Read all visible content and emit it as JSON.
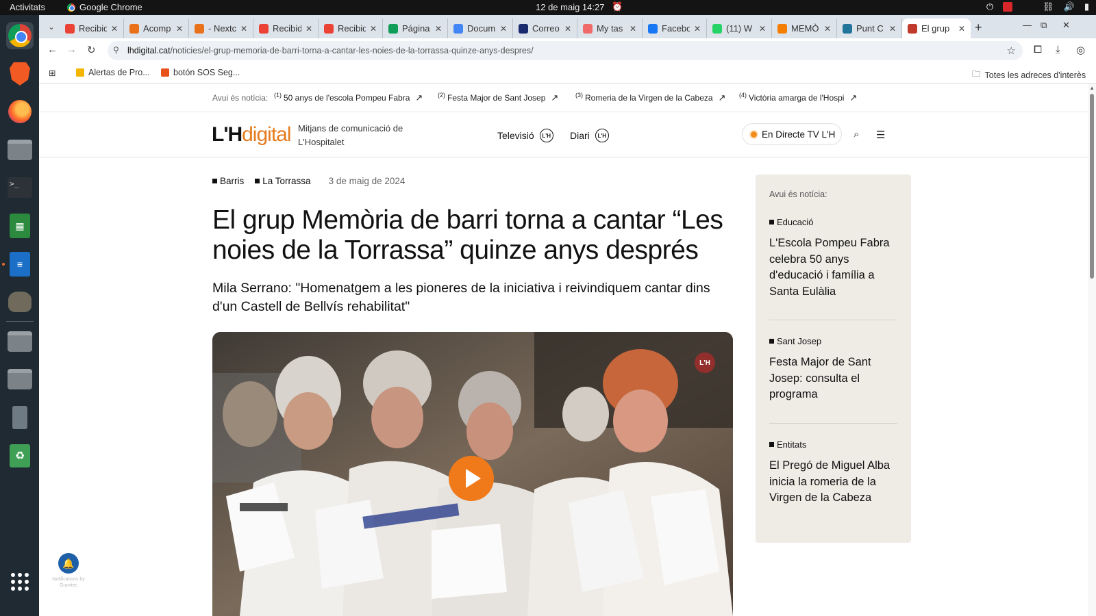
{
  "system_bar": {
    "activities": "Activitats",
    "app_name": "Google Chrome",
    "clock": "12 de maig  14:27"
  },
  "dock": {
    "apps": [
      "Google Chrome",
      "Brave",
      "Firefox",
      "Files",
      "Terminal",
      "LibreOffice Calc",
      "LibreOffice Writer",
      "GIMP",
      "Folder",
      "Folder",
      "USB",
      "Trash",
      "Show Apps"
    ]
  },
  "tabs": [
    {
      "title": "Recibid",
      "icon": "gmail-icon",
      "color": "#ea4335"
    },
    {
      "title": "Acomp",
      "icon": "orange-icon",
      "color": "#e8711a"
    },
    {
      "title": "- Nextc",
      "icon": "orange-icon",
      "color": "#e8711a"
    },
    {
      "title": "Recibid",
      "icon": "gmail-icon",
      "color": "#ea4335"
    },
    {
      "title": "Recibid",
      "icon": "gmail-icon",
      "color": "#ea4335"
    },
    {
      "title": "Página",
      "icon": "drive-icon",
      "color": "#0f9d58"
    },
    {
      "title": "Docum",
      "icon": "docs-icon",
      "color": "#4285f4"
    },
    {
      "title": "Correo",
      "icon": "x-icon",
      "color": "#1a2b6d"
    },
    {
      "title": "My tas",
      "icon": "asana-icon",
      "color": "#f06a6a"
    },
    {
      "title": "Facebo",
      "icon": "facebook-icon",
      "color": "#1877f2"
    },
    {
      "title": "(11) W",
      "icon": "whatsapp-icon",
      "color": "#25d366"
    },
    {
      "title": "MEMÒ",
      "icon": "blogger-icon",
      "color": "#f57d00"
    },
    {
      "title": "Punt C",
      "icon": "wordpress-icon",
      "color": "#21759b"
    },
    {
      "title": "El grup",
      "icon": "lh-icon",
      "color": "#c0392b",
      "active": true
    }
  ],
  "toolbar": {
    "url_domain": "lhdigital.cat",
    "url_path": "/noticies/el-grup-memoria-de-barri-torna-a-cantar-les-noies-de-la-torrassa-quinze-anys-despres/"
  },
  "bookmarks": {
    "items": [
      "Alertas de Pro...",
      "botón SOS Seg..."
    ],
    "all": "Totes les adreces d'interès"
  },
  "ticker": {
    "lead": "Avui és notícia:",
    "items": [
      {
        "num": "(1)",
        "text": "50 anys de l'escola Pompeu Fabra"
      },
      {
        "num": "(2)",
        "text": "Festa Major de Sant Josep"
      },
      {
        "num": "(3)",
        "text": "Romeria de la Virgen de la Cabeza"
      },
      {
        "num": "(4)",
        "text": "Victòria amarga de l'Hospi"
      }
    ]
  },
  "header": {
    "logo_lh": "L'H",
    "logo_digital": "digital",
    "tagline": "Mitjans de comunicació de L'Hospitalet",
    "nav": [
      {
        "label": "Televisió",
        "badge": "L'H"
      },
      {
        "label": "Diari",
        "badge": "L'H"
      }
    ],
    "live": "En Directe TV L'H"
  },
  "article": {
    "categories": [
      "Barris",
      "La Torrassa"
    ],
    "date": "3 de maig de 2024",
    "title": "El grup Memòria de barri torna a cantar “Les noies de la Torrassa” quinze anys després",
    "subtitle": "Mila Serrano: \"Homenatgem a les pioneres de la iniciativa i reivindiquem cantar dins d'un Castell de Bellvís rehabilitat\"",
    "video_watermark": "L'H"
  },
  "sidebar": {
    "lead": "Avui és notícia:",
    "items": [
      {
        "category": "Educació",
        "title": "L'Escola Pompeu Fabra celebra 50 anys d'educació i família a Santa Eulàlia"
      },
      {
        "category": "Sant Josep",
        "title": "Festa Major de Sant Josep: consulta el programa"
      },
      {
        "category": "Entitats",
        "title": "El Pregó de Miguel Alba inicia la romeria de la Virgen de la Cabeza"
      }
    ]
  },
  "notification_widget": {
    "label": "Notifications by Gravitec"
  },
  "colors": {
    "accent": "#e57b1e",
    "play": "#f07a1a",
    "sidebar_bg": "#efece6"
  }
}
